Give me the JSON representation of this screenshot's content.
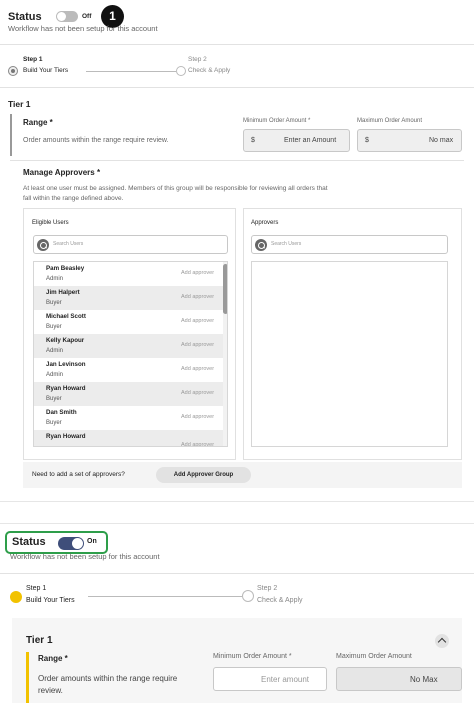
{
  "top": {
    "status_label": "Status",
    "toggle_text": "Off",
    "callout_number": "1",
    "workflow_note": "Workflow has not been setup for this account"
  },
  "steps": {
    "step1_num": "Step 1",
    "step1_label": "Build Your Tiers",
    "step2_num": "Step 2",
    "step2_label": "Check & Apply"
  },
  "tier": {
    "title": "Tier 1",
    "range_title": "Range *",
    "range_desc": "Order amounts within the range require review.",
    "min_label": "Minimum Order Amount *",
    "max_label": "Maximum Order Amount",
    "currency": "$",
    "min_placeholder": "Enter an Amount",
    "max_value": "No max"
  },
  "approvers": {
    "title": "Manage Approvers *",
    "desc_line1": "At least one user must be assigned.  Members of this group will be responsible for reviewing all orders that",
    "desc_line2": "fall within the range defined above.",
    "eligible_title": "Eligible Users",
    "approvers_title": "Approvers",
    "search_placeholder": "Search Users",
    "add_label": "Add approver",
    "users": [
      {
        "name": "Pam Beasley",
        "role": "Admin"
      },
      {
        "name": "Jim Halpert",
        "role": "Buyer"
      },
      {
        "name": "Michael Scott",
        "role": "Buyer"
      },
      {
        "name": "Kelly Kapour",
        "role": "Admin"
      },
      {
        "name": "Jan Levinson",
        "role": "Admin"
      },
      {
        "name": "Ryan Howard",
        "role": "Buyer"
      },
      {
        "name": "Dan Smith",
        "role": "Buyer"
      },
      {
        "name": "Ryan Howard",
        "role": ""
      }
    ],
    "group_question": "Need to add a set of approvers?",
    "group_button": "Add Approver Group"
  },
  "bottom": {
    "status_label": "Status",
    "toggle_text": "On",
    "workflow_note": "Workflow has not been setup for this account",
    "step1_num": "Step 1",
    "step1_label": "Build Your Tiers",
    "step2_num": "Step 2",
    "step2_label": "Check & Apply",
    "tier_title": "Tier 1",
    "range_title": "Range *",
    "range_desc_line1": "Order amounts within the range require",
    "range_desc_line2": "review.",
    "min_label": "Minimum Order Amount *",
    "max_label": "Maximum Order Amount",
    "min_placeholder": "Enter amount",
    "max_value": "No Max"
  },
  "colors": {
    "accent_yellow": "#f2c200",
    "toggle_on": "#3f4e7a",
    "highlight_green": "#2e9e4a"
  }
}
